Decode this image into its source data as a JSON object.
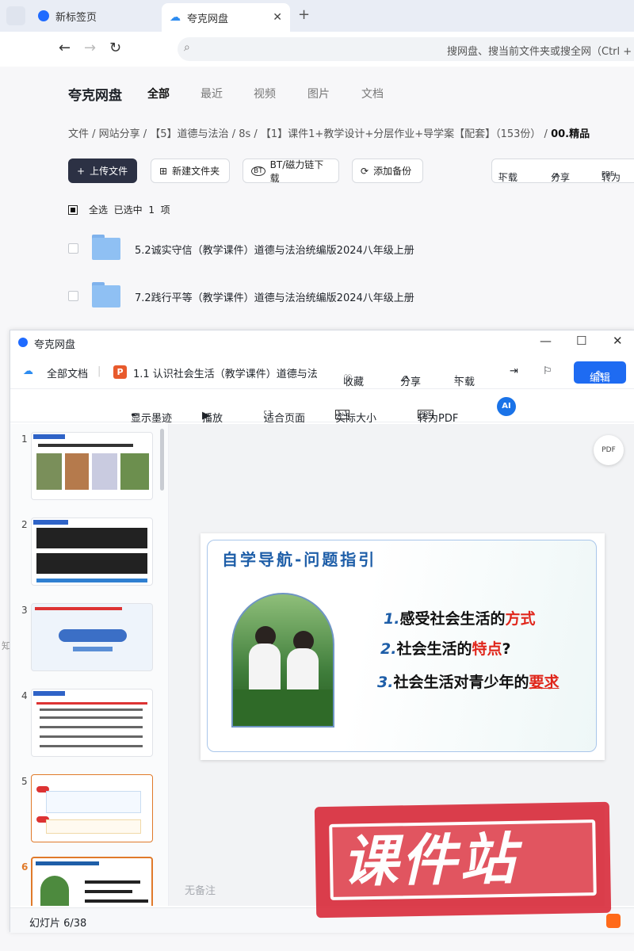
{
  "browser": {
    "tabs": [
      {
        "label": "新标签页"
      },
      {
        "label": "夸克网盘"
      }
    ],
    "address_hint": "搜网盘、搜当前文件夹或搜全网（Ctrl + F）"
  },
  "disk": {
    "title": "夸克网盘",
    "nav": [
      "全部",
      "最近",
      "视频",
      "图片",
      "文档"
    ],
    "breadcrumb": {
      "path": "文件 / 网站分享 / 【5】道德与法治 / 8s / 【1】课件1+教学设计+分层作业+导学案【配套】（153份） /",
      "current": "00.精品"
    },
    "buttons": {
      "upload": "上传文件",
      "new_folder": "新建文件夹",
      "bt": "BT/磁力链下载",
      "backup": "添加备份",
      "download": "下载",
      "share": "分享",
      "convert": "转为"
    },
    "selection": {
      "select_all": "全选",
      "selected": "已选中",
      "count": "1",
      "unit": "项"
    },
    "files": [
      {
        "name": "5.2诚实守信（教学课件）道德与法治统编版2024八年级上册"
      },
      {
        "name": "7.2践行平等（教学课件）道德与法治统编版2024八年级上册"
      }
    ]
  },
  "viewer": {
    "title": "夸克网盘",
    "toolbar1": {
      "all_docs": "全部文档",
      "doc_name": "1.1 认识社会生活（教学课件）道德与法",
      "favorite": "收藏",
      "share": "分享",
      "download": "下载",
      "edit": "编辑"
    },
    "toolbar2": {
      "ink": "显示墨迹",
      "play": "播放",
      "fit": "适合页面",
      "actual": "实际大小",
      "to_pdf": "转为PDF",
      "ai": "AI"
    },
    "thumbnails": [
      "1",
      "2",
      "3",
      "4",
      "5",
      "6"
    ],
    "selected_thumbnail": 6,
    "slide": {
      "title": "自学导航-问题指引",
      "questions": [
        {
          "num": "1.",
          "text": "感受社会生活的",
          "highlight": "方式",
          "suffix": ""
        },
        {
          "num": "2.",
          "text": "社会生活的",
          "highlight": "特点",
          "suffix": "?"
        },
        {
          "num": "3.",
          "text": "社会生活对青少年的",
          "highlight": "要求",
          "suffix": ""
        }
      ]
    },
    "no_remark": "无备注",
    "slide_counter": "幻灯片 6/38"
  },
  "watermark": {
    "text": "课件站"
  },
  "side_glyph": "知"
}
